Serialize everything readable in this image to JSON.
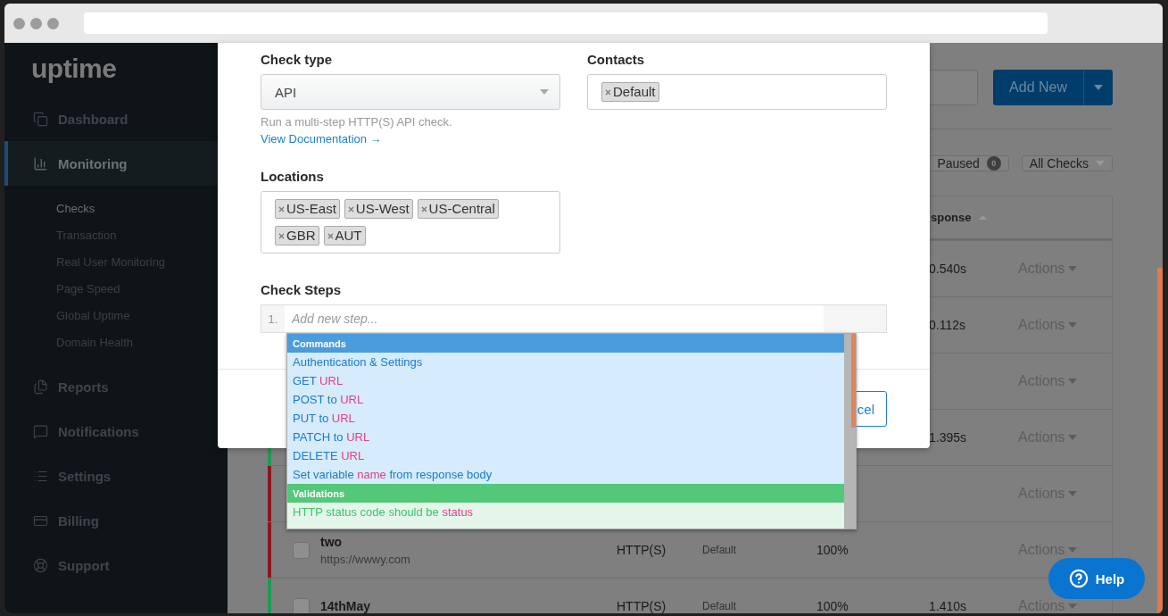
{
  "sidebar": {
    "logo": "uptime",
    "items": [
      {
        "label": "Dashboard",
        "selected": false
      },
      {
        "label": "Monitoring",
        "selected": true,
        "children": [
          {
            "label": "Checks",
            "selected": true
          },
          {
            "label": "Transaction",
            "selected": false
          },
          {
            "label": "Real User Monitoring",
            "selected": false
          },
          {
            "label": "Page Speed",
            "selected": false
          },
          {
            "label": "Global Uptime",
            "selected": false
          },
          {
            "label": "Domain Health",
            "selected": false
          }
        ]
      },
      {
        "label": "Reports",
        "selected": false
      },
      {
        "label": "Notifications",
        "selected": false
      },
      {
        "label": "Settings",
        "selected": false
      },
      {
        "label": "Billing",
        "selected": false
      },
      {
        "label": "Support",
        "selected": false
      }
    ]
  },
  "toolbar": {
    "add_button": "Add New"
  },
  "filters": [
    {
      "label": "Paused",
      "count": "0"
    },
    {
      "label": "All Checks"
    }
  ],
  "table": {
    "response_header": "sponse",
    "rows": [
      {
        "response": "0.540s",
        "actions": "Actions"
      },
      {
        "response": "0.112s",
        "actions": "Actions"
      },
      {
        "actions": "Actions"
      },
      {
        "color": "#1f9a55",
        "response": "1.395s",
        "actions": "Actions"
      },
      {
        "color": "#8a1620",
        "actions": "Actions"
      },
      {
        "color": "#8a1620",
        "checked": false,
        "name": "two",
        "url": "https://wwwy.com",
        "type": "HTTP(S)",
        "contacts": "Default",
        "uptime": "100%",
        "actions": "Actions"
      },
      {
        "color": "#1f9a55",
        "checked": false,
        "name": "14thMay",
        "type": "HTTP(S)",
        "contacts": "Default",
        "uptime": "100%",
        "response": "1.410s",
        "actions": "Actions"
      }
    ]
  },
  "modal": {
    "check_type": {
      "label": "Check type",
      "value": "API",
      "help": "Run a multi-step HTTP(S) API check.",
      "link": "View Documentation →"
    },
    "contacts": {
      "label": "Contacts",
      "tags": [
        "Default"
      ]
    },
    "locations": {
      "label": "Locations",
      "tags": [
        "US-East",
        "US-West",
        "US-Central",
        "GBR",
        "AUT"
      ]
    },
    "steps": {
      "label": "Check Steps",
      "number": "1.",
      "placeholder": "Add new step..."
    },
    "cancel_button": "cel"
  },
  "dropdown": {
    "groups": [
      {
        "title": "Commands",
        "kind": "command",
        "items": [
          [
            {
              "text": "Authentication & Settings",
              "kind": "word"
            }
          ],
          [
            {
              "text": "GET ",
              "kind": "word"
            },
            {
              "text": "URL",
              "kind": "param"
            }
          ],
          [
            {
              "text": "POST to ",
              "kind": "word"
            },
            {
              "text": "URL",
              "kind": "param"
            }
          ],
          [
            {
              "text": "PUT to ",
              "kind": "word"
            },
            {
              "text": "URL",
              "kind": "param"
            }
          ],
          [
            {
              "text": "PATCH to ",
              "kind": "word"
            },
            {
              "text": "URL",
              "kind": "param"
            }
          ],
          [
            {
              "text": "DELETE ",
              "kind": "word"
            },
            {
              "text": "URL",
              "kind": "param"
            }
          ],
          [
            {
              "text": "Set variable ",
              "kind": "word"
            },
            {
              "text": "name",
              "kind": "param"
            },
            {
              "text": " from response body",
              "kind": "word"
            }
          ]
        ]
      },
      {
        "title": "Validations",
        "kind": "validation",
        "items": [
          [
            {
              "text": "HTTP status code should be ",
              "kind": "word"
            },
            {
              "text": "status",
              "kind": "param"
            }
          ]
        ]
      }
    ]
  },
  "help_button": "Help"
}
